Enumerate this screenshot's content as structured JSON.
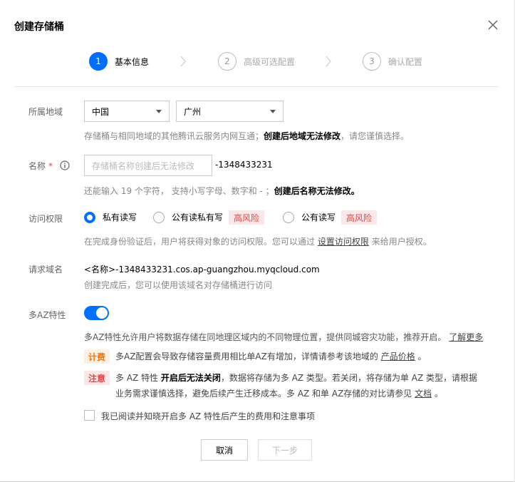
{
  "dialog": {
    "title": "创建存储桶"
  },
  "steps": [
    {
      "num": "1",
      "label": "基本信息",
      "active": true
    },
    {
      "num": "2",
      "label": "高级可选配置",
      "active": false
    },
    {
      "num": "3",
      "label": "确认配置",
      "active": false
    }
  ],
  "region": {
    "label": "所属地域",
    "country": "中国",
    "city": "广州",
    "hint_prefix": "存储桶与相同地域的其他腾讯云服务内网互通；",
    "hint_bold": "创建后地域无法修改",
    "hint_suffix": "，请您谨慎选择。"
  },
  "name": {
    "label": "名称",
    "required_mark": "*",
    "placeholder": "存储桶名称创建后无法修改",
    "suffix": "-1348433231",
    "hint_prefix": "还能输入 19 个字符，  支持小写字母、数字和 - ；",
    "hint_bold": "创建后名称无法修改。"
  },
  "access": {
    "label": "访问权限",
    "options": [
      {
        "label": "私有读写",
        "selected": true
      },
      {
        "label": "公有读私有写",
        "selected": false,
        "tag": "高风险"
      },
      {
        "label": "公有读写",
        "selected": false,
        "tag": "高风险"
      }
    ],
    "hint_prefix": "在完成身份验证后，用户将获得对象的访问权限。您可以通过",
    "hint_link": "设置访问权限",
    "hint_suffix": "来给用户授权。"
  },
  "domain": {
    "label": "请求域名",
    "value": "<名称>-1348433231.cos.ap-guangzhou.myqcloud.com",
    "hint": "创建完成后，您可以使用该域名对存储桶进行访问"
  },
  "multi_az": {
    "label": "多AZ特性",
    "enabled": true,
    "desc": "多AZ特性允许用户将数据存储在同地理区域内的不同物理位置，提供同城容灾功能，推荐开启。",
    "desc_link": "了解更多",
    "fee_badge": "计费",
    "fee_text": "多AZ配置会导致存储容量费用相比单AZ有增加，详情请参考该地域的",
    "fee_link": "产品价格",
    "fee_end": "。",
    "note_badge": "注意",
    "note_line1_prefix": "多 AZ 特性",
    "note_line1_bold": "开启后无法关闭",
    "note_line1_suffix": "，数据将存储为多 AZ 类型。若关闭，将存储为单 AZ 类型，请根据",
    "note_line2_prefix": "业务需求谨慎选择，避免后续产生迁移成本。多 AZ 和单 AZ存储的对比请参见",
    "note_line2_link": "文档",
    "note_line2_end": "。",
    "agree_label": "我已阅读并知晓开启多 AZ 特性后产生的费用和注意事项"
  },
  "footer": {
    "cancel": "取消",
    "next": "下一步"
  },
  "colors": {
    "primary": "#006eff",
    "danger": "#e54545",
    "warning": "#ff7200"
  }
}
